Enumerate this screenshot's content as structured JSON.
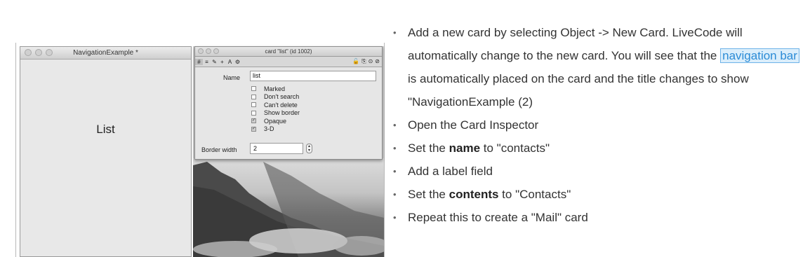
{
  "main_window": {
    "title": "NavigationExample *",
    "card_label": "List"
  },
  "inspector": {
    "title": "card \"list\" (id 1002)",
    "toolbar_left": [
      "#",
      "≡",
      "✎",
      "+",
      "A",
      "⚙"
    ],
    "toolbar_right": [
      "⊙",
      "⊘"
    ],
    "name_label": "Name",
    "name_value": "list",
    "checkboxes": [
      {
        "label": "Marked",
        "checked": false
      },
      {
        "label": "Don't search",
        "checked": false
      },
      {
        "label": "Can't delete",
        "checked": false
      },
      {
        "label": "Show border",
        "checked": false
      },
      {
        "label": "Opaque",
        "checked": true
      },
      {
        "label": "3-D",
        "checked": true
      }
    ],
    "border_width_label": "Border width",
    "border_width_value": "2"
  },
  "instructions": {
    "step1_before": "Add a new card by selecting Object -> New Card. LiveCode will automatically change to the new card. You will see that the ",
    "step1_highlight": "navigation bar",
    "step1_after": " is automatically placed on the card and the title changes to show \"NavigationExample (2)",
    "step2": "Open the Card Inspector",
    "step3_before": "Set the ",
    "step3_bold": "name",
    "step3_after": " to \"contacts\"",
    "step4": "Add a label field",
    "step5_before": "Set the ",
    "step5_bold": "contents",
    "step5_after": " to \"Contacts\"",
    "step6": "Repeat this to create a \"Mail\" card"
  },
  "colors": {
    "highlight_text": "#2b8bd6",
    "highlight_bg": "#dbeefb"
  }
}
